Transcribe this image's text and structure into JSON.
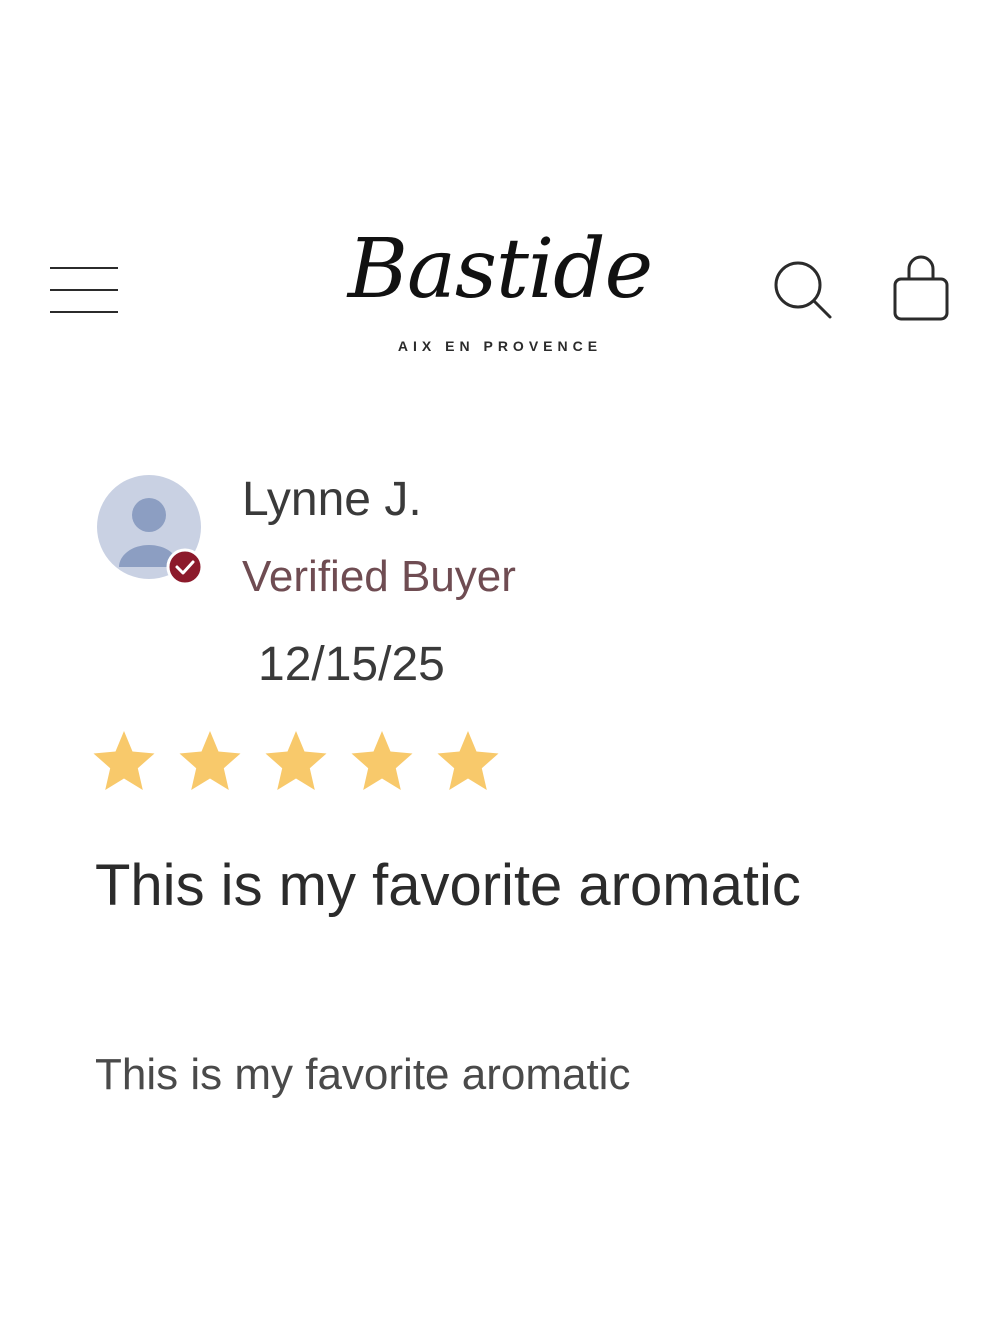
{
  "header": {
    "logo_text": "Bastide",
    "logo_tagline": "AIX EN PROVENCE",
    "icons": {
      "menu": "hamburger-menu-icon",
      "search": "search-icon",
      "bag": "shopping-bag-icon"
    }
  },
  "review": {
    "author": "Lynne J.",
    "verified_label": "Verified Buyer",
    "date": "12/15/25",
    "rating": 5,
    "rating_max": 5,
    "title": "This is my favorite aromatic",
    "body": "This is my favorite aromatic"
  },
  "colors": {
    "text": "#2b2b2b",
    "verified_text": "#6f4c52",
    "verified_badge": "#8c1a2b",
    "avatar_bg": "#c9d1e3",
    "avatar_figure": "#8c9ec2",
    "star": "#f8c96b"
  }
}
